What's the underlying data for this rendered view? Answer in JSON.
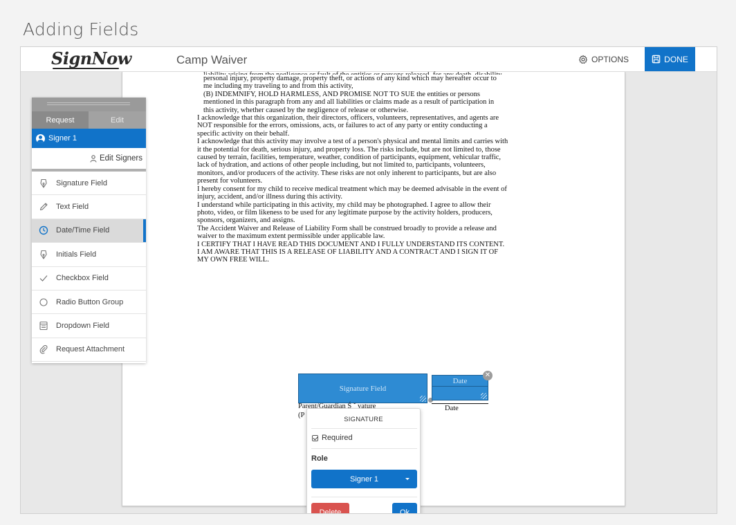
{
  "page": {
    "title": "Adding Fields"
  },
  "topbar": {
    "logo": "SignNow",
    "doc_title": "Camp Waiver",
    "options_label": "OPTIONS",
    "done_label": "DONE",
    "options_icon": "gear-icon",
    "done_icon": "save-icon",
    "accent": "#1173c9"
  },
  "document": {
    "cut_line": "liability arising from the negligence or fault of the entities or persons released, for any death, disability,",
    "paragraphs": [
      {
        "indent": true,
        "text": "personal injury, property damage, property theft, or actions of any kind which may hereafter occur to"
      },
      {
        "indent": true,
        "text": "me including my traveling to and from this activity,"
      },
      {
        "indent": true,
        "text": "(B) INDEMNIFY, HOLD HARMLESS, AND PROMISE NOT TO SUE the entities or persons"
      },
      {
        "indent": true,
        "text": "mentioned in this paragraph from any and all liabilities or claims made as a result of participation in"
      },
      {
        "indent": true,
        "text": "this activity, whether caused by the negligence of release or otherwise."
      },
      {
        "indent": false,
        "text": "I acknowledge that this organization, their directors, officers, volunteers, representatives, and agents are"
      },
      {
        "indent": false,
        "text": "NOT responsible for the errors, omissions, acts, or failures to act of any party or entity conducting a"
      },
      {
        "indent": false,
        "text": "specific activity on their behalf."
      },
      {
        "indent": false,
        "text": "I acknowledge that this activity may involve a test of a person's physical and mental limits and carries with"
      },
      {
        "indent": false,
        "text": "it the potential for death, serious injury, and property loss. The risks include, but are not limited to, those"
      },
      {
        "indent": false,
        "text": "caused by terrain, facilities, temperature, weather, condition of participants, equipment, vehicular traffic,"
      },
      {
        "indent": false,
        "text": "lack of hydration, and actions of other people including, but not limited to, participants, volunteers,"
      },
      {
        "indent": false,
        "text": "monitors, and/or producers of the activity. These risks are not only inherent to participants, but are also"
      },
      {
        "indent": false,
        "text": "present for volunteers."
      },
      {
        "indent": false,
        "text": "I hereby consent for my child to receive medical treatment which may be deemed advisable in the event of"
      },
      {
        "indent": false,
        "text": "injury, accident, and/or illness during this activity."
      },
      {
        "indent": false,
        "text": "I understand while participating in this activity, my child may be photographed. I agree to allow their"
      },
      {
        "indent": false,
        "text": "photo, video, or film likeness to be used for any legitimate purpose by the activity holders, producers,"
      },
      {
        "indent": false,
        "text": "sponsors, organizers, and assigns."
      },
      {
        "indent": false,
        "text": "The Accident Waiver and Release of Liability Form shall be construed broadly to provide a release and"
      },
      {
        "indent": false,
        "text": "waiver to the maximum extent permissible under applicable law."
      },
      {
        "indent": false,
        "text": "I CERTIFY THAT I HAVE READ THIS DOCUMENT AND I FULLY UNDERSTAND ITS CONTENT."
      },
      {
        "indent": false,
        "text": "I AM AWARE THAT THIS IS A RELEASE OF LIABILITY AND A CONTRACT AND I SIGN IT OF"
      },
      {
        "indent": false,
        "text": "MY OWN FREE WILL."
      }
    ],
    "signature_field_label": "Signature Field",
    "date_field_label": "Date",
    "signature_line_label": "Parent/Guardian Ś ˇ vature",
    "signature_line_label2": "(P",
    "date_line_label": "Date"
  },
  "popover": {
    "title": "SIGNATURE",
    "required_label": "Required",
    "required_checked": true,
    "role_label": "Role",
    "role_value": "Signer 1",
    "delete_label": "Delete",
    "ok_label": "Ok",
    "delete_color": "#d9534f"
  },
  "sidebar": {
    "tab_request": "Request",
    "tab_edit": "Edit",
    "signer": "Signer 1",
    "edit_signers": "Edit Signers",
    "fields": [
      {
        "label": "Signature Field",
        "icon": "pen-nib-icon"
      },
      {
        "label": "Text Field",
        "icon": "pencil-icon"
      },
      {
        "label": "Date/Time Field",
        "icon": "clock-icon",
        "active": true
      },
      {
        "label": "Initials Field",
        "icon": "pen-nib-icon"
      },
      {
        "label": "Checkbox Field",
        "icon": "checkmark-icon"
      },
      {
        "label": "Radio Button Group",
        "icon": "radio-circle-icon"
      },
      {
        "label": "Dropdown Field",
        "icon": "dropdown-list-icon"
      },
      {
        "label": "Request Attachment",
        "icon": "paperclip-icon"
      }
    ]
  }
}
